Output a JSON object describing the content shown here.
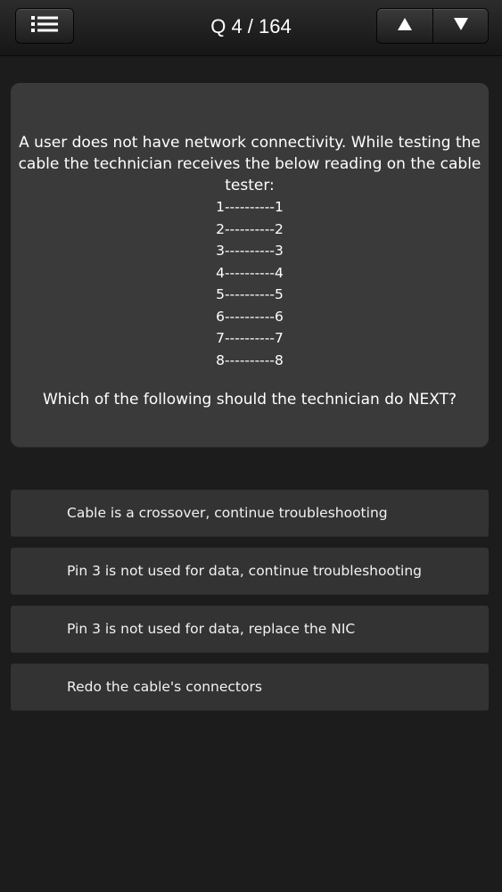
{
  "header": {
    "title": "Q 4 / 164",
    "menu_icon": "list-icon",
    "prev_icon": "triangle-up-icon",
    "next_icon": "triangle-down-icon"
  },
  "question": {
    "lines": [
      "A user does not have network connectivity. While testing the",
      "cable the technician receives the below reading on the cable",
      "tester:"
    ],
    "pins": [
      "1----------1",
      "2----------2",
      "3----------3",
      "4----------4",
      "5----------5",
      "6----------6",
      "7----------7",
      "8----------8"
    ],
    "prompt": "Which of the following should the technician do NEXT?"
  },
  "answers": [
    "Cable is a crossover, continue troubleshooting",
    "Pin 3 is not used for data, continue troubleshooting",
    "Pin 3 is not used for data, replace the NIC",
    "Redo the cable's connectors"
  ],
  "colors": {
    "background": "#1c1c1c",
    "card": "#3a3a3a",
    "answer": "#333333",
    "text": "#ffffff"
  }
}
